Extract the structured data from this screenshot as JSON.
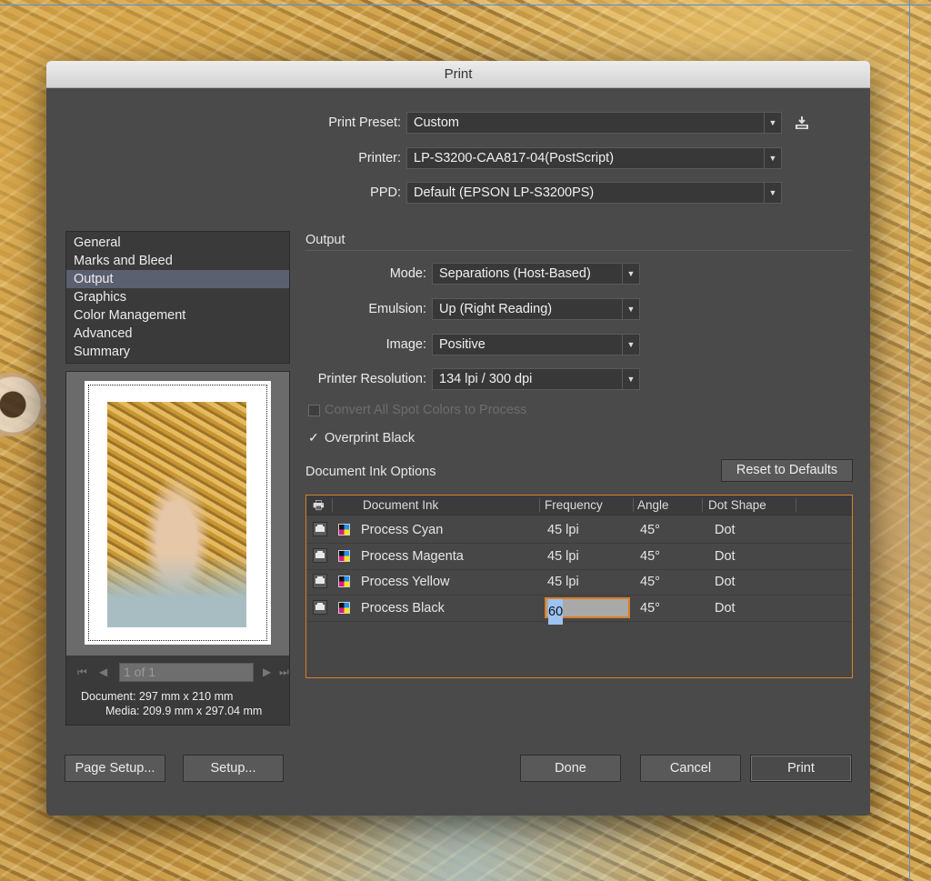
{
  "dialog": {
    "title": "Print"
  },
  "preset": {
    "label": "Print Preset:",
    "value": "Custom"
  },
  "printer": {
    "label": "Printer:",
    "value": "LP-S3200-CAA817-04(PostScript)"
  },
  "ppd": {
    "label": "PPD:",
    "value": "Default (EPSON LP-S3200PS)"
  },
  "nav": {
    "items": [
      "General",
      "Marks and Bleed",
      "Output",
      "Graphics",
      "Color Management",
      "Advanced",
      "Summary"
    ],
    "selected": "Output"
  },
  "preview": {
    "page_field": "1 of 1",
    "document_info": "Document: 297 mm x 210 mm",
    "media_info": "Media: 209.9 mm x 297.04 mm"
  },
  "output": {
    "section_title": "Output",
    "mode": {
      "label": "Mode:",
      "value": "Separations (Host-Based)"
    },
    "emulsion": {
      "label": "Emulsion:",
      "value": "Up (Right Reading)"
    },
    "image": {
      "label": "Image:",
      "value": "Positive"
    },
    "resolution": {
      "label": "Printer Resolution:",
      "value": "134 lpi / 300 dpi"
    },
    "convert_spot": {
      "label": "Convert All Spot Colors to Process",
      "checked": false,
      "enabled": false
    },
    "overprint_black": {
      "label": "Overprint Black",
      "checked": true
    }
  },
  "ink_options": {
    "title": "Document Ink Options",
    "reset_button": "Reset to Defaults",
    "columns": [
      "Document Ink",
      "Frequency",
      "Angle",
      "Dot Shape"
    ],
    "rows": [
      {
        "ink": "Process Cyan",
        "frequency": "45 lpi",
        "angle": "45°",
        "dot_shape": "Dot"
      },
      {
        "ink": "Process Magenta",
        "frequency": "45 lpi",
        "angle": "45°",
        "dot_shape": "Dot"
      },
      {
        "ink": "Process Yellow",
        "frequency": "45 lpi",
        "angle": "45°",
        "dot_shape": "Dot"
      },
      {
        "ink": "Process Black",
        "frequency": "60",
        "angle": "45°",
        "dot_shape": "Dot"
      }
    ]
  },
  "buttons": {
    "page_setup": "Page Setup...",
    "setup": "Setup...",
    "done": "Done",
    "cancel": "Cancel",
    "print": "Print"
  },
  "icons": {
    "save_preset": "save-preset-icon",
    "printer": "printer-icon",
    "process_color": "process-color-icon"
  },
  "colors": {
    "dialog_bg": "#4a4a4a",
    "focus_accent": "#d97f27",
    "selection": "#5b6070"
  }
}
